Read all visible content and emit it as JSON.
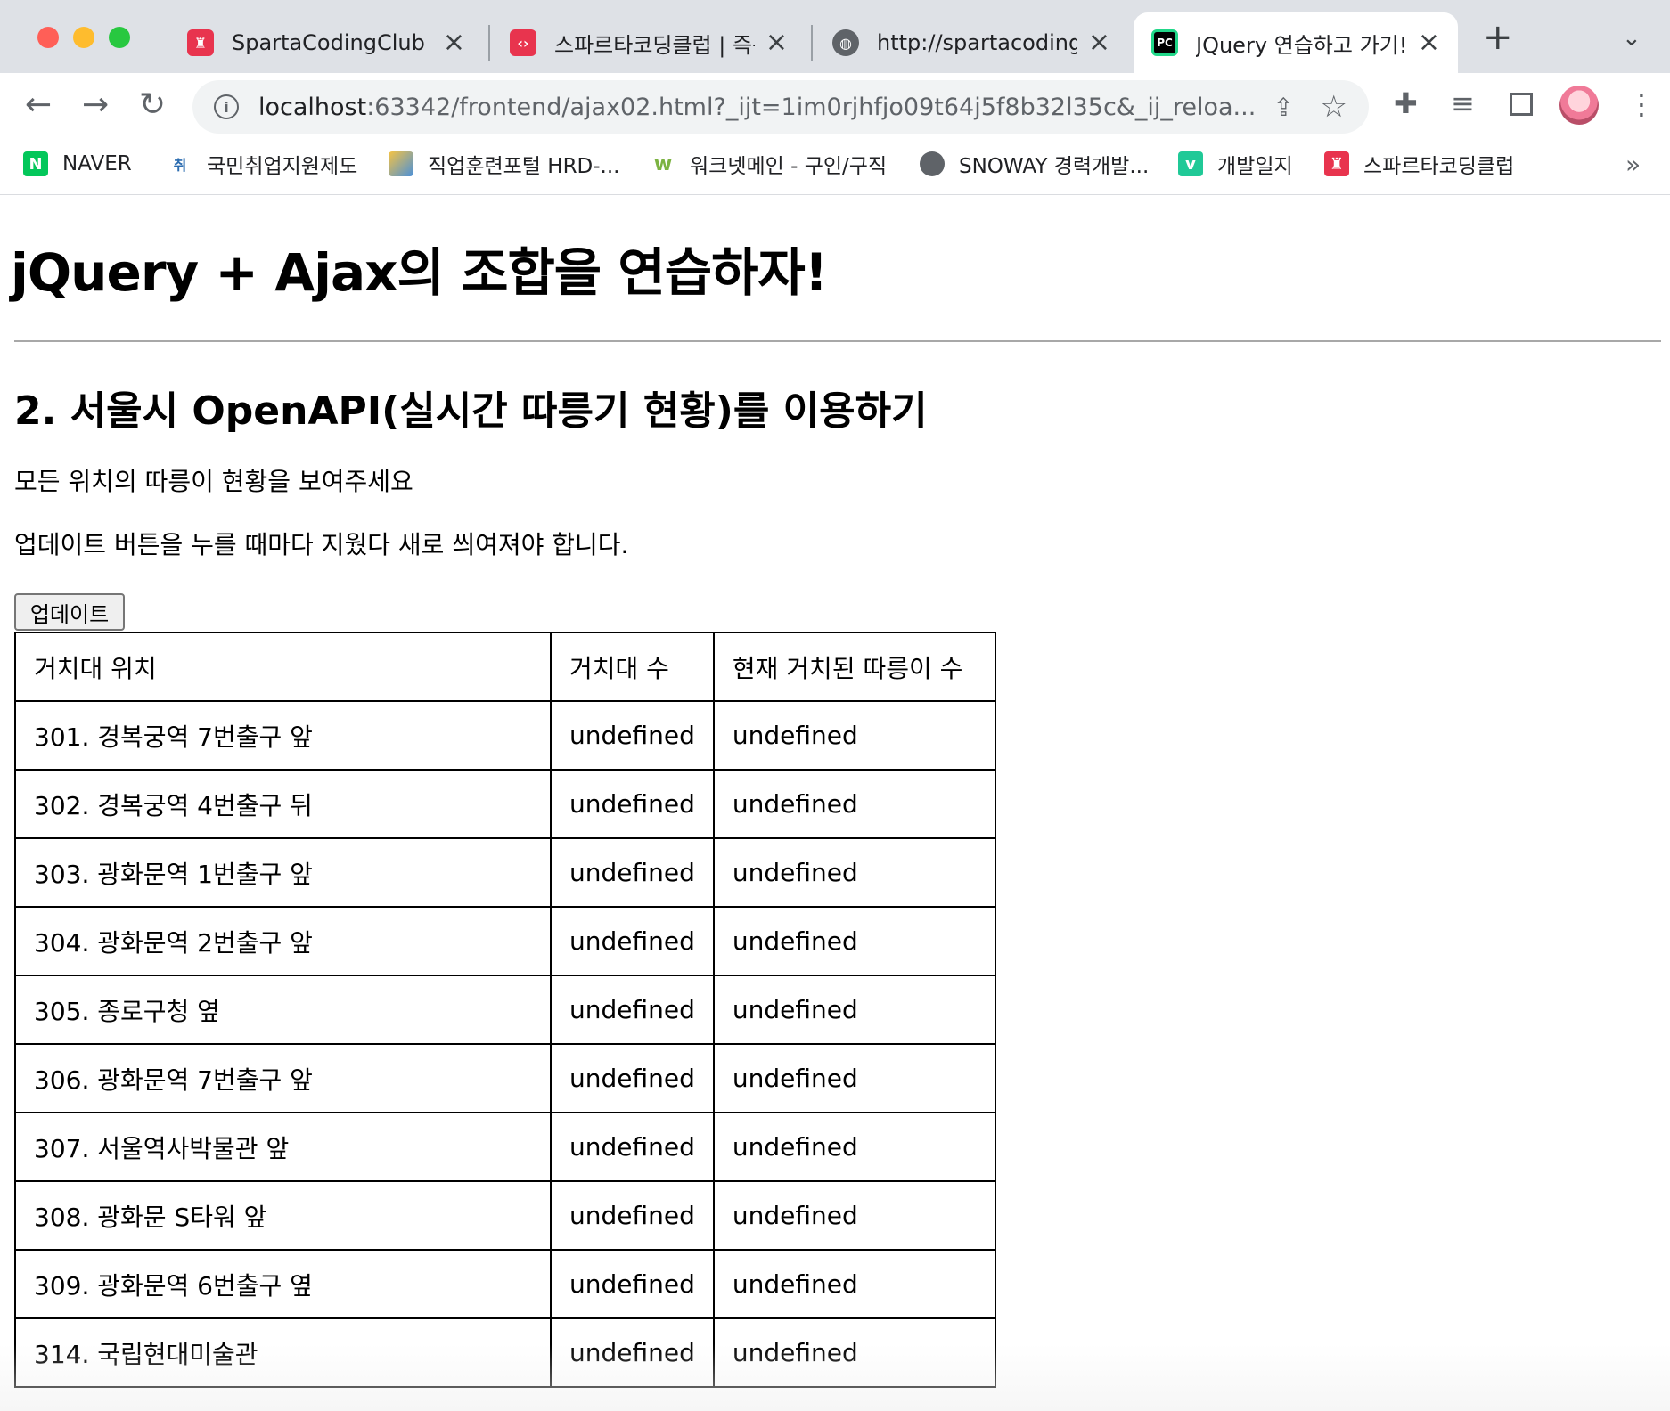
{
  "tabs": [
    {
      "title": "SpartaCodingClub",
      "icon": "sparta-favicon",
      "color": "#e8344e",
      "active": false
    },
    {
      "title": "스파르타코딩클럽 | 즉문",
      "icon": "sparta-code-favicon",
      "color": "#e8344e",
      "active": false
    },
    {
      "title": "http://spartacodingcl",
      "icon": "globe-favicon",
      "color": "#5f6368",
      "active": false
    },
    {
      "title": "JQuery 연습하고 가기!",
      "icon": "pycharm-favicon",
      "color": "#21d789",
      "active": true
    }
  ],
  "address_bar": {
    "host": "localhost",
    "rest": ":63342/frontend/ajax02.html?_ijt=1im0rjhfjo09t64j5f8b32l35c&_ij_reloa..."
  },
  "bookmarks": [
    {
      "label": "NAVER",
      "icon": "naver-icon",
      "mark": "N",
      "color": "#03c75a"
    },
    {
      "label": "국민취업지원제도",
      "icon": "employment-icon",
      "mark": "취",
      "color": "#2b6cb0"
    },
    {
      "label": "직업훈련포털 HRD-...",
      "icon": "hrd-icon",
      "mark": "",
      "color": "#4a90d9"
    },
    {
      "label": "워크넷메인 - 구인/구직",
      "icon": "worknet-icon",
      "mark": "w",
      "color": "#7cb342"
    },
    {
      "label": "SNOWAY 경력개발...",
      "icon": "globe-icon",
      "mark": "",
      "color": "#5f6368"
    },
    {
      "label": "개발일지",
      "icon": "velog-icon",
      "mark": "v",
      "color": "#20c997"
    },
    {
      "label": "스파르타코딩클럽",
      "icon": "sparta-icon",
      "mark": "",
      "color": "#e8344e"
    }
  ],
  "page": {
    "title": "jQuery + Ajax의 조합을 연습하자!",
    "section_title": "2. 서울시 OpenAPI(실시간 따릉기 현황)를 이용하기",
    "desc1": "모든 위치의 따릉이 현황을 보여주세요",
    "desc2": "업데이트 버튼을 누를 때마다 지웠다 새로 씌여져야 합니다.",
    "update_button": "업데이트"
  },
  "table": {
    "headers": [
      "거치대 위치",
      "거치대 수",
      "현재 거치된 따릉이 수"
    ],
    "rows": [
      [
        "301. 경복궁역 7번출구 앞",
        "undefined",
        "undefined"
      ],
      [
        "302. 경복궁역 4번출구 뒤",
        "undefined",
        "undefined"
      ],
      [
        "303. 광화문역 1번출구 앞",
        "undefined",
        "undefined"
      ],
      [
        "304. 광화문역 2번출구 앞",
        "undefined",
        "undefined"
      ],
      [
        "305. 종로구청 옆",
        "undefined",
        "undefined"
      ],
      [
        "306. 광화문역 7번출구 앞",
        "undefined",
        "undefined"
      ],
      [
        "307. 서울역사박물관 앞",
        "undefined",
        "undefined"
      ],
      [
        "308. 광화문 S타워 앞",
        "undefined",
        "undefined"
      ],
      [
        "309. 광화문역 6번출구 옆",
        "undefined",
        "undefined"
      ],
      [
        "314. 국립현대미술관",
        "undefined",
        "undefined"
      ]
    ]
  }
}
